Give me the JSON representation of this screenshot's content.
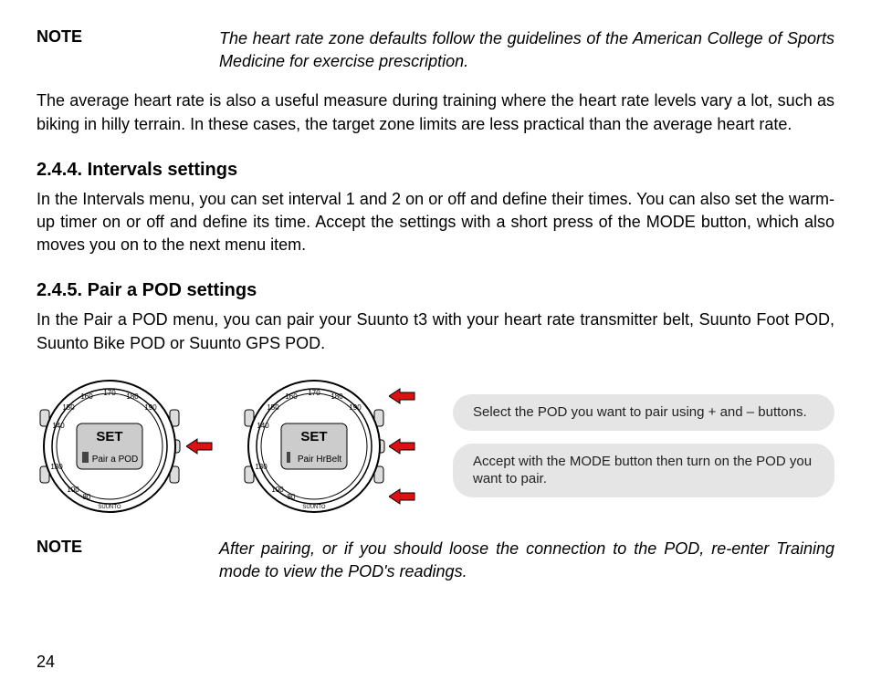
{
  "note1": {
    "label": "NOTE",
    "text": "The heart rate zone defaults follow the guidelines of the American College of Sports Medicine for exercise prescription."
  },
  "para1": "The average heart rate is also a useful measure during training where the heart rate levels vary a lot, such as biking in hilly terrain. In these cases, the target zone limits are less practical than the average heart rate.",
  "section_intervals": {
    "heading": "2.4.4. Intervals settings",
    "body": "In the Intervals menu, you can set interval 1 and 2 on or off and define their times. You can also set the warm-up timer on or off and define its time. Accept the settings with a short press of the MODE button, which also moves you on to the next menu item."
  },
  "section_pair": {
    "heading": "2.4.5. Pair a POD settings",
    "body": "In the Pair a POD menu, you can pair your Suunto t3 with your heart rate transmitter belt, Suunto Foot POD, Suunto Bike POD or Suunto GPS POD."
  },
  "diagram": {
    "watch1": {
      "line1": "SET",
      "line2": "Pair a POD"
    },
    "watch2": {
      "line1": "SET",
      "line2": "Pair  HrBelt"
    },
    "callout1": "Select the POD you want to pair using + and – buttons.",
    "callout2": "Accept with the MODE button then turn on the POD you want to pair."
  },
  "note2": {
    "label": "NOTE",
    "text": "After pairing, or if you should loose the connection to the POD, re-enter Training mode to view the POD's readings."
  },
  "page_number": "24",
  "icons": {
    "brand": "SUUNTO"
  }
}
